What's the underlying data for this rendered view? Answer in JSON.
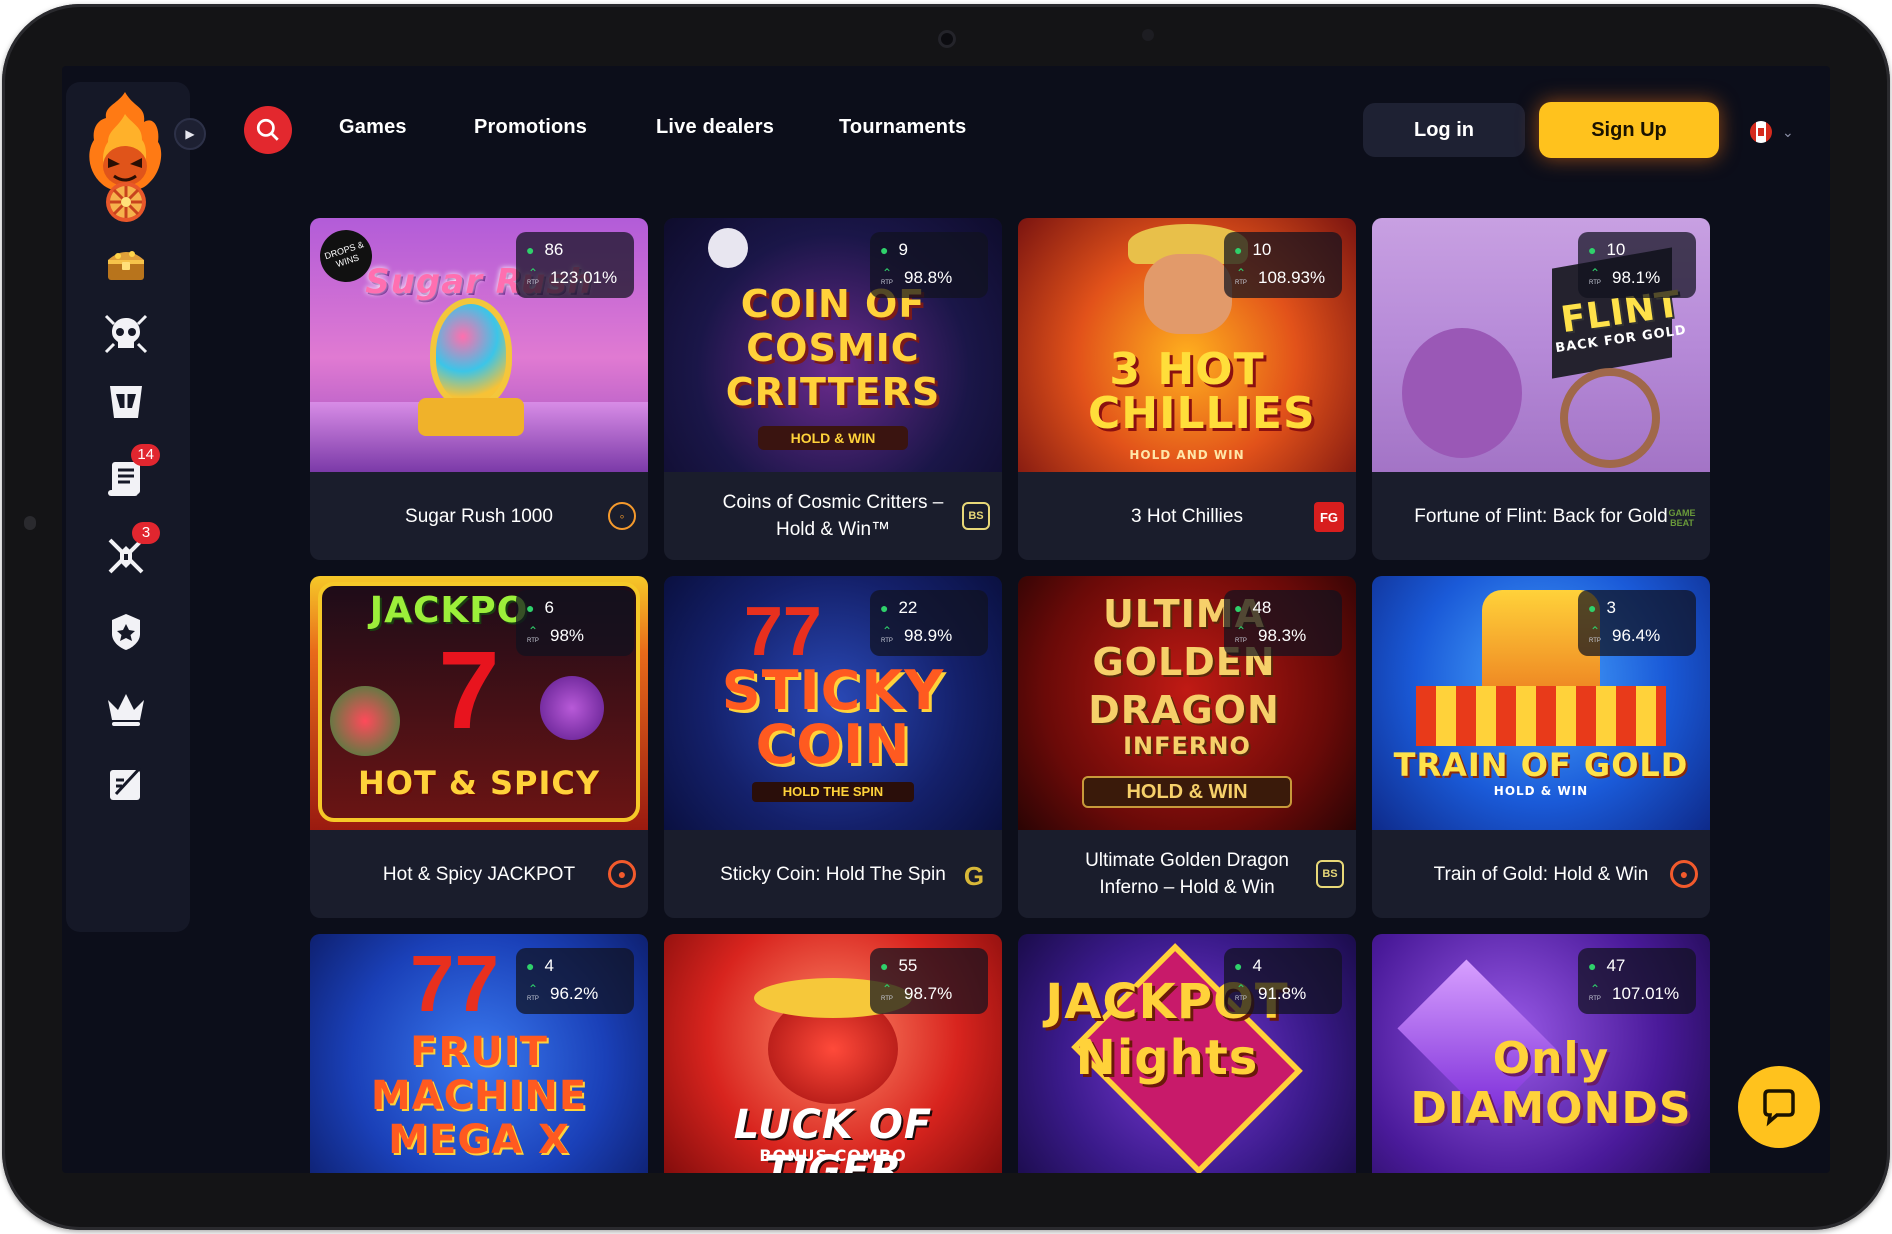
{
  "nav": {
    "items": [
      "Games",
      "Promotions",
      "Live dealers",
      "Tournaments"
    ],
    "login": "Log in",
    "signup": "Sign Up"
  },
  "sidebar": {
    "icons": [
      "fire-mascot-logo",
      "wheel-icon",
      "treasure-chest-icon",
      "skull-icon",
      "helmet-icon",
      "scroll-icon",
      "crossed-swords-icon",
      "shield-icon",
      "crown-icon",
      "book-icon"
    ],
    "badges": {
      "scroll": "14",
      "swords": "3"
    }
  },
  "games": [
    {
      "name": "Sugar Rush 1000",
      "players": "86",
      "rtp": "123.01%",
      "art_title": "Sugar Rush",
      "tag": "DROPS & WINS"
    },
    {
      "name": "Coins of Cosmic Critters – Hold & Win™",
      "players": "9",
      "rtp": "98.8%",
      "art_title": "COIN OF COSMIC CRITTERS",
      "art_sub": "HOLD & WIN"
    },
    {
      "name": "3 Hot Chillies",
      "players": "10",
      "rtp": "108.93%",
      "art_title": "3 HOT CHILLIES",
      "art_sub": "HOLD AND WIN",
      "provider": "FG"
    },
    {
      "name": "Fortune of Flint: Back for Gold",
      "players": "10",
      "rtp": "98.1%",
      "art_title": "FLINT",
      "art_sub": "BACK FOR GOLD",
      "provider": "GAME BEAT"
    },
    {
      "name": "Hot & Spicy JACKPOT",
      "players": "6",
      "rtp": "98%",
      "art_title": "JACKPO",
      "art_sub": "HOT & SPICY"
    },
    {
      "name": "Sticky Coin: Hold The Spin",
      "players": "22",
      "rtp": "98.9%",
      "art_title": "STICKY COIN",
      "art_sub": "HOLD THE SPIN"
    },
    {
      "name": "Ultimate Golden Dragon Inferno – Hold & Win",
      "players": "48",
      "rtp": "98.3%",
      "art_title": "ULTIMA GOLDEN DRAGON",
      "art_sub": "INFERNO",
      "art_sub2": "HOLD & WIN"
    },
    {
      "name": "Train of Gold: Hold & Win",
      "players": "3",
      "rtp": "96.4%",
      "art_title": "TRAIN OF GOLD",
      "art_sub": "HOLD & WIN"
    },
    {
      "name": "",
      "players": "4",
      "rtp": "96.2%",
      "art_title": "FRUIT MACHINE MEGA X"
    },
    {
      "name": "",
      "players": "55",
      "rtp": "98.7%",
      "art_title": "LUCK OF TIGER",
      "art_sub": "BONUS COMBO"
    },
    {
      "name": "",
      "players": "4",
      "rtp": "91.8%",
      "art_title": "JACKPOT Nights"
    },
    {
      "name": "",
      "players": "47",
      "rtp": "107.01%",
      "art_title": "Only DIAMONDS"
    }
  ],
  "colors": {
    "accent": "#ffc21d",
    "search": "#e3282e",
    "background": "#0c0e1a",
    "card": "#1a1d2c"
  }
}
